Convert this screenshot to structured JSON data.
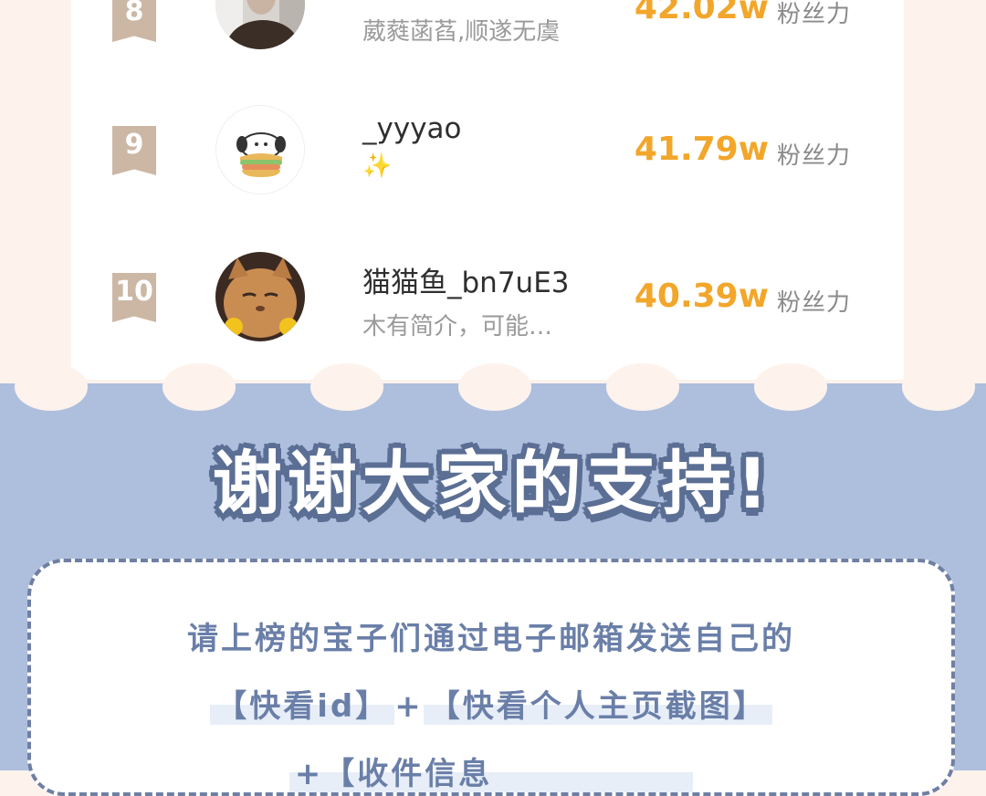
{
  "ranking": [
    {
      "rank": "8",
      "name": "",
      "bio": "葳蕤菡萏,顺遂无虞",
      "score": "42.02w",
      "unit": "粉丝力"
    },
    {
      "rank": "9",
      "name": "_yyyao",
      "bio": "✨",
      "score": "41.79w",
      "unit": "粉丝力"
    },
    {
      "rank": "10",
      "name": "猫猫鱼_bn7uE3",
      "bio": "木有简介，可能…",
      "score": "40.39w",
      "unit": "粉丝力"
    }
  ],
  "thanks_title": "谢谢大家的支持!",
  "notice": {
    "line1": "请上榜的宝子们通过电子邮箱发送自己的",
    "line2_a": "【快看id】",
    "line2_plus": "+",
    "line2_b": "【快看个人主页截图】",
    "line3": "+【收件信息"
  },
  "colors": {
    "score": "#f2a62a",
    "rank_badge": "#ccb7a5",
    "blue_panel": "#aebfde",
    "notice_text": "#6a7fa8"
  }
}
